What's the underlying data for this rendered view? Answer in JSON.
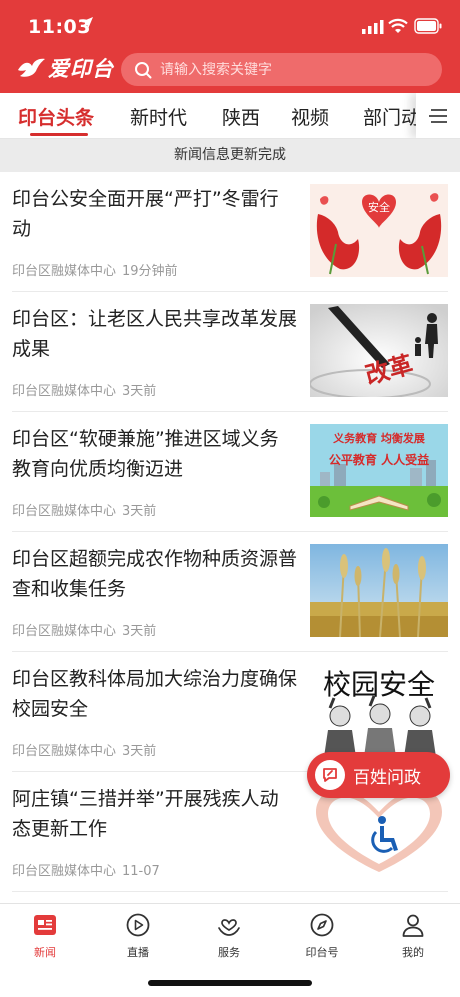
{
  "status": {
    "time": "11:03"
  },
  "brand": {
    "name": "爱印台"
  },
  "search": {
    "placeholder": "请输入搜索关键字"
  },
  "tabs": [
    {
      "label": "印台头条",
      "active": true
    },
    {
      "label": "新时代"
    },
    {
      "label": "陕西"
    },
    {
      "label": "视频"
    },
    {
      "label": "部门动"
    }
  ],
  "notice": "新闻信息更新完成",
  "news": [
    {
      "title": "印台公安全面开展“严打”冬雷行动",
      "source": "印台区融媒体中心",
      "time": "19分钟前",
      "thumb_text": "安全"
    },
    {
      "title": "印台区：让老区人民共享改革发展成果",
      "source": "印台区融媒体中心",
      "time": "3天前",
      "thumb_text": "改革"
    },
    {
      "title": "印台区“软硬兼施”推进区域义务教育向优质均衡迈进",
      "source": "印台区融媒体中心",
      "time": "3天前",
      "thumb_text_1": "义务教育 均衡发展",
      "thumb_text_2": "公平教育 人人受益"
    },
    {
      "title": "印台区超额完成农作物种质资源普查和收集任务",
      "source": "印台区融媒体中心",
      "time": "3天前"
    },
    {
      "title": "印台区教科体局加大综治力度确保校园安全",
      "source": "印台区融媒体中心",
      "time": "3天前",
      "thumb_text": "校园安全"
    },
    {
      "title": "阿庄镇“三措并举”开展残疾人动态更新工作",
      "source": "印台区融媒体中心",
      "time": "11-07"
    }
  ],
  "fab": {
    "label": "百姓问政"
  },
  "tabbar": [
    {
      "label": "新闻",
      "icon": "news-icon",
      "active": true
    },
    {
      "label": "直播",
      "icon": "live-icon"
    },
    {
      "label": "服务",
      "icon": "service-icon"
    },
    {
      "label": "印台号",
      "icon": "compass-icon"
    },
    {
      "label": "我的",
      "icon": "profile-icon"
    }
  ],
  "colors": {
    "accent": "#e33b3b",
    "active_tab": "#d62e2e"
  }
}
